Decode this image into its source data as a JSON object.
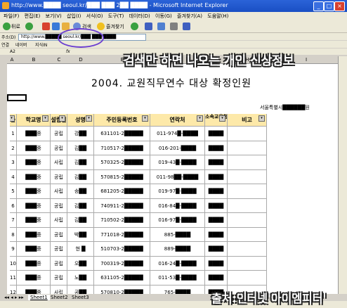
{
  "window": {
    "title": "http://www.████ seoul.kr/███ ███ 2██ ████ - Microsoft Internet Explorer"
  },
  "menu": [
    "파일(F)",
    "편집(E)",
    "보기(V)",
    "삽입(I)",
    "서식(O)",
    "도구(T)",
    "데이터(D)",
    "이동(G)",
    "즐겨찾기(A)",
    "도움말(H)"
  ],
  "toolbar": {
    "back": "뒤로",
    "search": "검색",
    "favorites": "즐겨찾기"
  },
  "address": {
    "label": "주소(D)",
    "url": "http://www.█████ seoul.kr/███ ███ ████"
  },
  "links": [
    "네이버",
    "지식IN"
  ],
  "formula": {
    "cell": "A2",
    "fx": "fx"
  },
  "overlay": {
    "headline": "검색만 하면 나오는 개인 신상정보",
    "credit": "출처:인터넷'아이엠피터'"
  },
  "sheet": {
    "title": "2004. 교원직무연수 대상 확정인원",
    "sub": "서울특별시██████원",
    "columns": [
      "A",
      "B",
      "C",
      "D",
      "E",
      "F",
      "G",
      "H",
      "I"
    ],
    "headers": [
      "순",
      "학교명",
      "설립별",
      "성명",
      "주민등록번호",
      "연락처",
      "소속교육청",
      "비고"
    ],
    "rows": [
      [
        "1",
        "███중",
        "공립",
        "강██",
        "631101-2█████",
        "011-974█-████",
        "████"
      ],
      [
        "2",
        "███중",
        "공립",
        "김██",
        "710517-2█████",
        "016-201-████",
        "████"
      ],
      [
        "3",
        "███중",
        "사립",
        "김██",
        "570325-2█████",
        "019-43█-████",
        "████"
      ],
      [
        "4",
        "███중",
        "공립",
        "김██",
        "570815-2█████",
        "011-98██-████",
        "████"
      ],
      [
        "5",
        "███중",
        "사립",
        "송██",
        "681205-2█████",
        "019-97█-████",
        "████"
      ],
      [
        "6",
        "███중",
        "공립",
        "김██",
        "740911-2█████",
        "016-84█-████",
        "████"
      ],
      [
        "7",
        "███중",
        "사립",
        "김██",
        "710502-2█████",
        "016-97█-████",
        "████"
      ],
      [
        "8",
        "███중",
        "공립",
        "박██",
        "771018-2█████",
        "885-████",
        "████"
      ],
      [
        "9",
        "███중",
        "공립",
        "현 █",
        "510703-2█████",
        "889-████",
        "████"
      ],
      [
        "10",
        "███중",
        "공립",
        "오██",
        "700319-2█████",
        "016-24█-████",
        "████"
      ],
      [
        "11",
        "███중",
        "공립",
        "노██",
        "631105-2█████",
        "011-53█-████",
        "████"
      ],
      [
        "12",
        "███중",
        "사립",
        "공██",
        "570810-2█████",
        "765-████",
        "████"
      ]
    ],
    "tabs": [
      "Sheet1",
      "Sheet2",
      "Sheet3"
    ]
  }
}
